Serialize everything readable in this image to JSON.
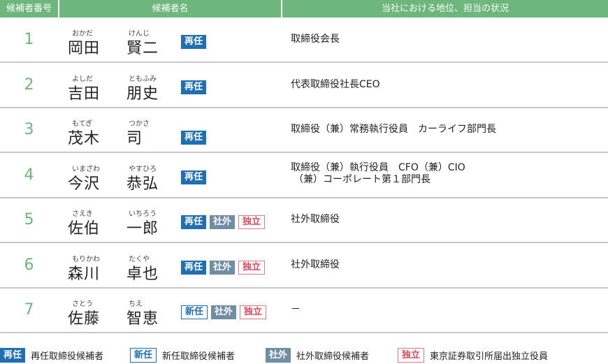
{
  "header": {
    "col_number": "候補者番号",
    "col_name": "候補者名",
    "col_role": "当社における地位、担当の状況"
  },
  "rows": [
    {
      "number": "1",
      "surname_kana": "おかだ",
      "given_kana": "けんじ",
      "surname": "岡田",
      "given": "賢二",
      "badges": [
        "再任"
      ],
      "role_line1": "取締役会長",
      "role_line2": ""
    },
    {
      "number": "2",
      "surname_kana": "よしだ",
      "given_kana": "ともふみ",
      "surname": "吉田",
      "given": "朋史",
      "badges": [
        "再任"
      ],
      "role_line1": "代表取締役社長CEO",
      "role_line2": ""
    },
    {
      "number": "3",
      "surname_kana": "もてぎ",
      "given_kana": "つかさ",
      "surname": "茂木",
      "given": "司",
      "badges": [
        "再任"
      ],
      "role_line1": "取締役（兼）常務執行役員　カーライフ部門長",
      "role_line2": ""
    },
    {
      "number": "4",
      "surname_kana": "いまざわ",
      "given_kana": "やすひろ",
      "surname": "今沢",
      "given": "恭弘",
      "badges": [
        "再任"
      ],
      "role_line1": "取締役（兼）執行役員　CFO（兼）CIO",
      "role_line2": "（兼）コーポレート第１部門長"
    },
    {
      "number": "5",
      "surname_kana": "さえき",
      "given_kana": "いちろう",
      "surname": "佐伯",
      "given": "一郎",
      "badges": [
        "再任",
        "社外",
        "独立"
      ],
      "role_line1": "社外取締役",
      "role_line2": ""
    },
    {
      "number": "6",
      "surname_kana": "もりかわ",
      "given_kana": "たくや",
      "surname": "森川",
      "given": "卓也",
      "badges": [
        "再任",
        "社外",
        "独立"
      ],
      "role_line1": "社外取締役",
      "role_line2": ""
    },
    {
      "number": "7",
      "surname_kana": "さとう",
      "given_kana": "ちえ",
      "surname": "佐藤",
      "given": "智恵",
      "badges": [
        "新任",
        "社外",
        "独立"
      ],
      "role_line1": "－",
      "role_line2": ""
    }
  ],
  "legend": [
    {
      "badge": "再任",
      "text": "再任取締役候補者"
    },
    {
      "badge": "新任",
      "text": "新任取締役候補者"
    },
    {
      "badge": "社外",
      "text": "社外取締役候補者"
    },
    {
      "badge": "独立",
      "text": "東京証券取引所届出独立役員"
    }
  ],
  "colors": {
    "header_green": "#6db67c",
    "number_green": "#6db67c",
    "badge_blue": "#1f6fb2",
    "badge_gray_blue": "#6f8ea6",
    "badge_red": "#d94a5a"
  }
}
